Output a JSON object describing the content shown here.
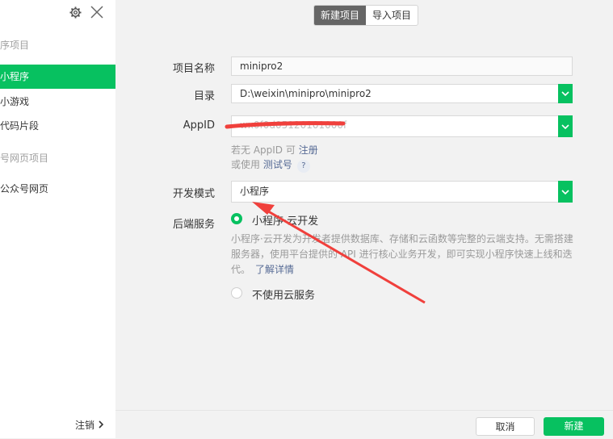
{
  "sidebar": {
    "sections": [
      {
        "title": "序项目",
        "items": [
          "小程序",
          "小游戏",
          "代码片段"
        ]
      },
      {
        "title": "号网页项目",
        "items": [
          "公众号网页"
        ]
      }
    ],
    "active_item": "小程序",
    "logout_label": "注销",
    "logout_icon": "chevron-right-icon",
    "settings_icon": "gear-icon",
    "close_icon": "close-icon"
  },
  "tabs": [
    "新建项目",
    "导入项目"
  ],
  "active_tab": "新建项目",
  "form": {
    "project_name": {
      "label": "项目名称",
      "value": "minipro2"
    },
    "directory": {
      "label": "目录",
      "value": "D:\\weixin\\minipro\\minipro2"
    },
    "appid": {
      "label": "AppID",
      "value": "wx0f0d05120101000f"
    },
    "appid_hint": {
      "prefix": "若无 AppID 可",
      "link": "注册",
      "prefix2": "或使用",
      "link2": "测试号",
      "help": "?"
    },
    "dev_mode": {
      "label": "开发模式",
      "value": "小程序"
    },
    "backend": {
      "label": "后端服务",
      "option1": "小程序·云开发",
      "option1_desc": "小程序·云开发为开发者提供数据库、存储和云函数等完整的云端支持。无需搭建服务器，使用平台提供的 API 进行核心业务开发，即可实现小程序快速上线和迭代。",
      "learn_more": "了解详情",
      "option2": "不使用云服务"
    }
  },
  "buttons": {
    "cancel": "取消",
    "create": "新建"
  },
  "colors": {
    "accent": "#07c160",
    "annotation": "#f0403c",
    "link": "#576b95"
  }
}
